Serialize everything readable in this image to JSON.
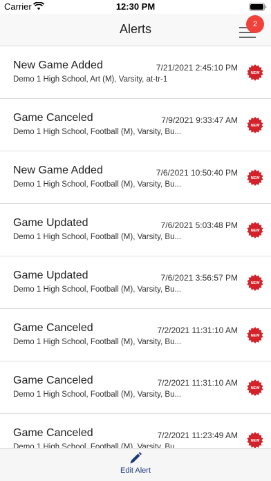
{
  "status_bar": {
    "carrier": "Carrier",
    "time": "12:30 PM",
    "wifi_icon": "wifi-icon",
    "battery_icon": "battery-icon"
  },
  "nav": {
    "title": "Alerts",
    "menu_icon": "hamburger-menu-icon",
    "badge_count": "2",
    "badge_color": "#f0413a"
  },
  "alerts": [
    {
      "title": "New Game Added",
      "date": "7/21/2021 2:45:10 PM",
      "description": "Demo 1 High School, Art (M), Varsity, at-tr-1",
      "badge": "NEW"
    },
    {
      "title": "Game Canceled",
      "date": "7/9/2021 9:33:47 AM",
      "description": "Demo 1 High School, Football (M), Varsity, Bu...",
      "badge": "NEW"
    },
    {
      "title": "New Game Added",
      "date": "7/6/2021 10:50:40 PM",
      "description": "Demo 1 High School, Football (M), Varsity, Bu...",
      "badge": "NEW"
    },
    {
      "title": "Game Updated",
      "date": "7/6/2021 5:03:48 PM",
      "description": "Demo 1 High School, Football (M), Varsity, Bu...",
      "badge": "NEW"
    },
    {
      "title": "Game Updated",
      "date": "7/6/2021 3:56:57 PM",
      "description": "Demo 1 High School, Football (M), Varsity, Bu...",
      "badge": "NEW"
    },
    {
      "title": "Game Canceled",
      "date": "7/2/2021 11:31:10 AM",
      "description": "Demo 1 High School, Football (M), Varsity, Bu...",
      "badge": "NEW"
    },
    {
      "title": "Game Canceled",
      "date": "7/2/2021 11:31:10 AM",
      "description": "Demo 1 High School, Football (M), Varsity, Bu...",
      "badge": "NEW"
    },
    {
      "title": "Game Canceled",
      "date": "7/2/2021 11:23:49 AM",
      "description": "Demo 1 High School, Football (M), Varsity, Bu...",
      "badge": "NEW"
    }
  ],
  "badge_color": "#d3222a",
  "toolbar": {
    "edit_label": "Edit Alert",
    "edit_icon": "pencil-icon",
    "accent_color": "#1f3a7a"
  }
}
